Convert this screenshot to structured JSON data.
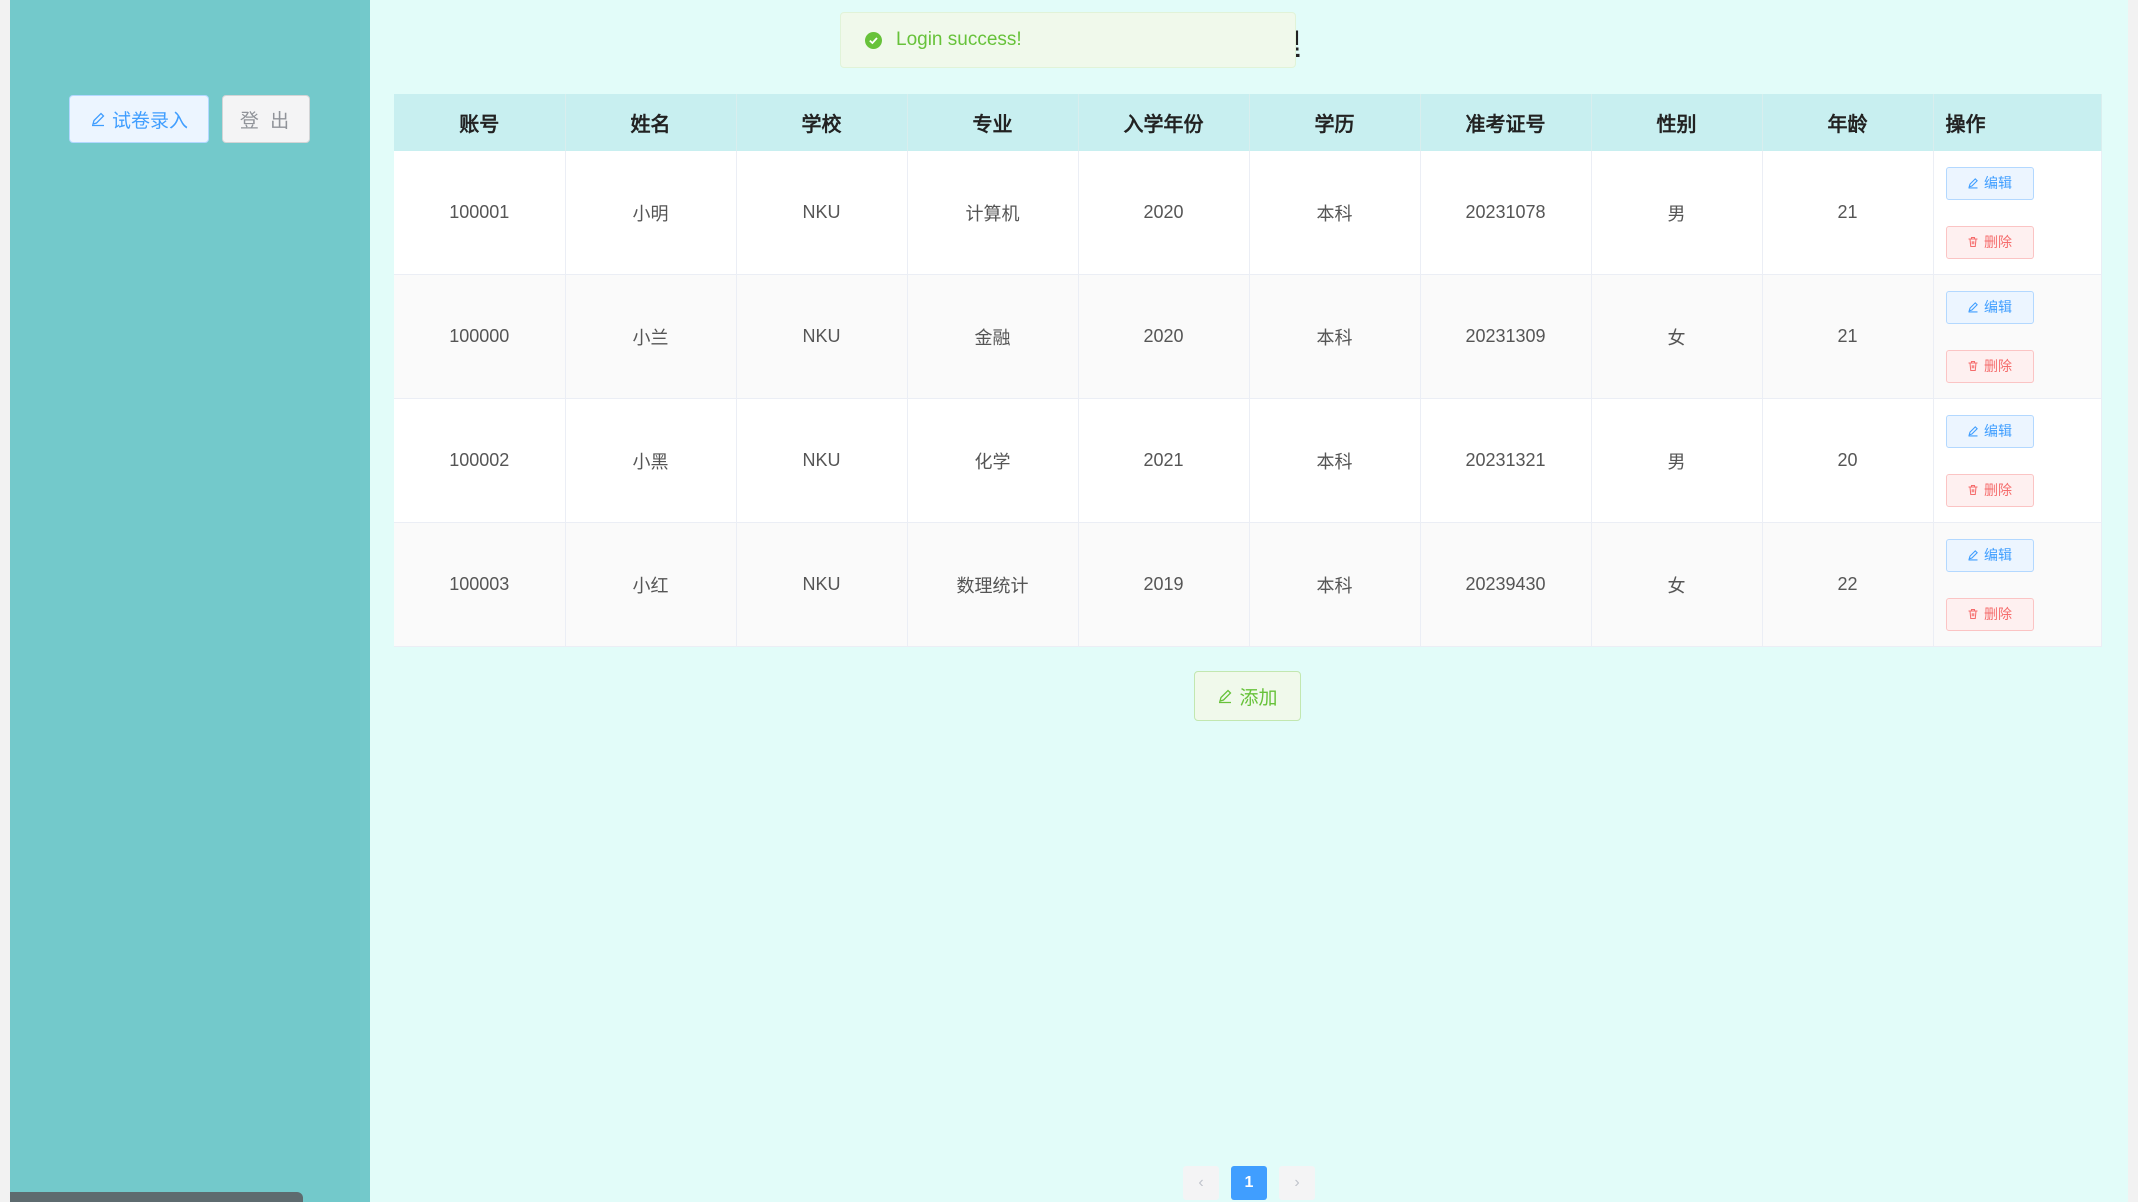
{
  "sidebar": {
    "exam_entry_label": "试卷录入",
    "logout_label": "登 出"
  },
  "header": {
    "title_visible": "理"
  },
  "toast": {
    "message": "Login success!"
  },
  "table": {
    "columns": [
      "账号",
      "姓名",
      "学校",
      "专业",
      "入学年份",
      "学历",
      "准考证号",
      "性别",
      "年龄",
      "操作"
    ],
    "rows": [
      [
        "100001",
        "小明",
        "NKU",
        "计算机",
        "2020",
        "本科",
        "20231078",
        "男",
        "21"
      ],
      [
        "100000",
        "小兰",
        "NKU",
        "金融",
        "2020",
        "本科",
        "20231309",
        "女",
        "21"
      ],
      [
        "100002",
        "小黑",
        "NKU",
        "化学",
        "2021",
        "本科",
        "20231321",
        "男",
        "20"
      ],
      [
        "100003",
        "小红",
        "NKU",
        "数理统计",
        "2019",
        "本科",
        "20239430",
        "女",
        "22"
      ]
    ],
    "edit_label": "编辑",
    "delete_label": "删除"
  },
  "add_label": "添加",
  "pagination": {
    "prev": "‹",
    "current": "1",
    "next": "›"
  },
  "colors": {
    "sidebar_bg": "#73c9cb",
    "main_bg": "#e2fcf9",
    "primary": "#409eff",
    "success": "#67c23a",
    "danger": "#f56c6c"
  }
}
